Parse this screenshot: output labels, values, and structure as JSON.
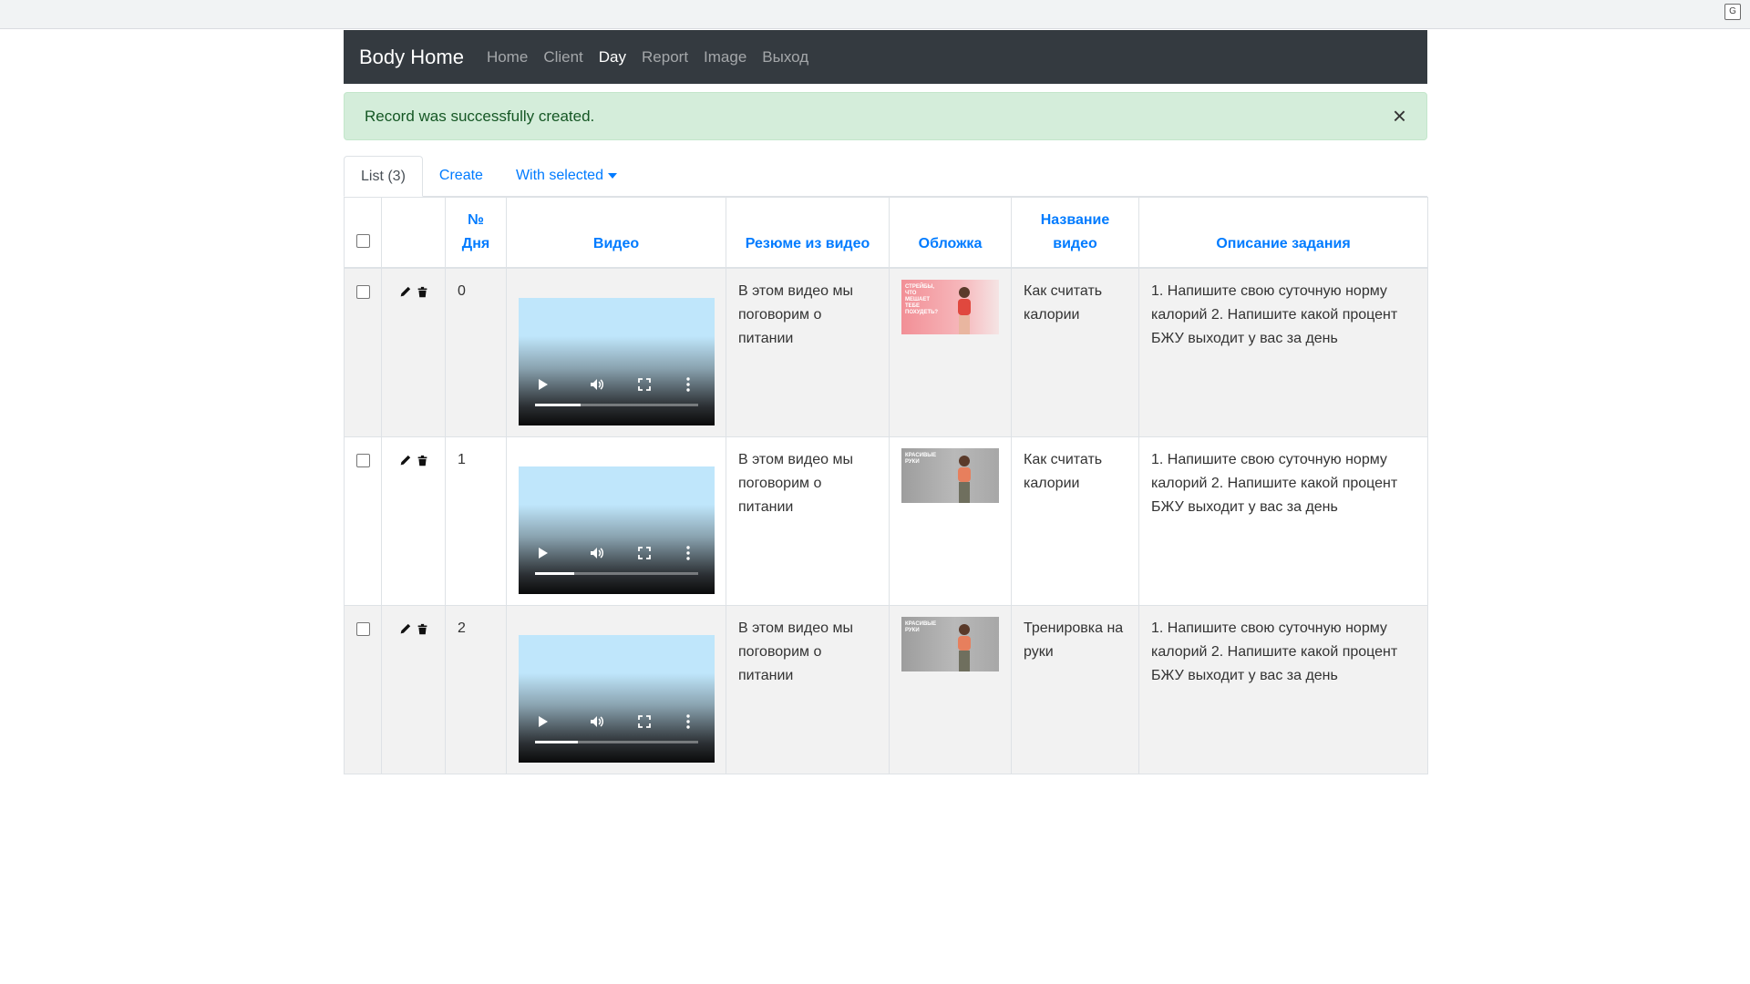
{
  "navbar": {
    "brand": "Body Home",
    "links": [
      {
        "label": "Home",
        "active": false
      },
      {
        "label": "Client",
        "active": false
      },
      {
        "label": "Day",
        "active": true
      },
      {
        "label": "Report",
        "active": false
      },
      {
        "label": "Image",
        "active": false
      },
      {
        "label": "Выход",
        "active": false
      }
    ]
  },
  "alert": {
    "message": "Record was successfully created.",
    "close": "×",
    "color": "#d4edda"
  },
  "tabs": {
    "list": "List (3)",
    "create": "Create",
    "with_selected": "With selected"
  },
  "table": {
    "headers": {
      "day": "№ Дня",
      "video": "Видео",
      "summary": "Резюме из видео",
      "cover": "Обложка",
      "title": "Название видео",
      "task": "Описание задания"
    },
    "rows": [
      {
        "day": "0",
        "progress": 0.28,
        "summary": "В этом видео мы поговорим о питании",
        "cover_text": "СТРЕЙБЫ, ЧТО МЕШАЕТ ТЕБЕ ПОХУДЕТЬ?",
        "title": "Как считать калории",
        "task": "1. Напишите свою суточную норму калорий 2. Напишите какой процент БЖУ выходит у вас за день"
      },
      {
        "day": "1",
        "progress": 0.24,
        "summary": "В этом видео мы поговорим о питании",
        "cover_text": "КРАСИВЫЕ РУКИ",
        "title": "Как считать калории",
        "task": "1. Напишите свою суточную норму калорий 2. Напишите какой процент БЖУ выходит у вас за день"
      },
      {
        "day": "2",
        "progress": 0.26,
        "summary": "В этом видео мы поговорим о питании",
        "cover_text": "КРАСИВЫЕ РУКИ",
        "title": "Тренировка на руки",
        "task": "1. Напишите свою суточную норму калорий 2. Напишите какой процент БЖУ выходит у вас за день"
      }
    ]
  },
  "icons": {
    "edit": "pencil-icon",
    "delete": "trash-icon",
    "play": "play-icon",
    "volume": "volume-icon",
    "fullscreen": "fullscreen-icon",
    "more": "more-vert-icon",
    "translate": "translate-icon"
  }
}
